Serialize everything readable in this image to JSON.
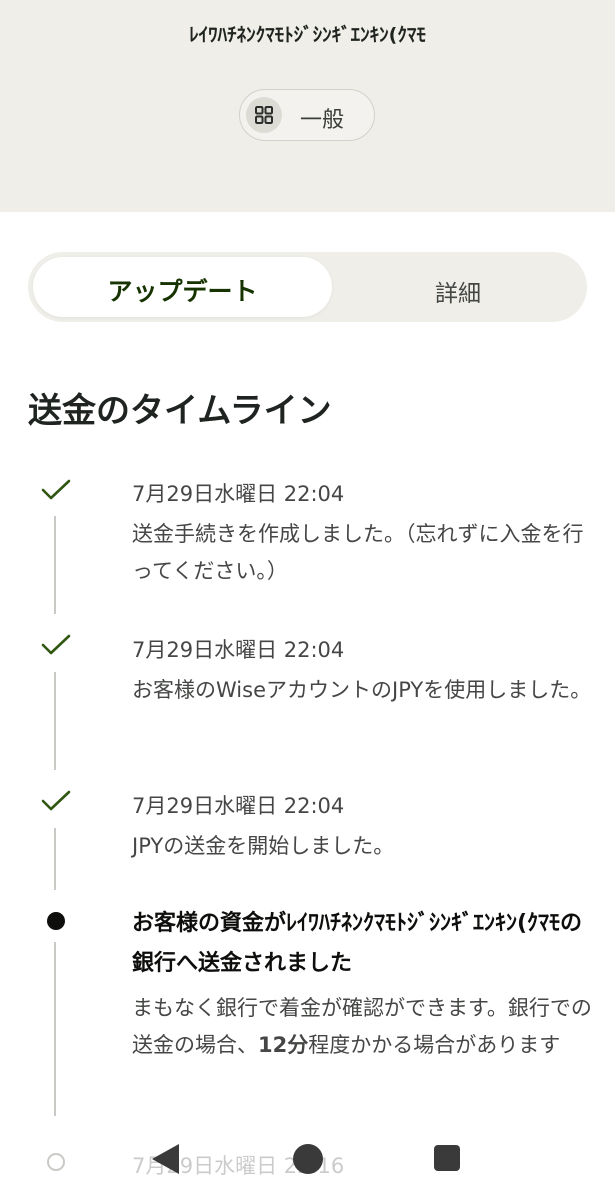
{
  "header": {
    "recipient_name": "ﾚｲﾜﾊﾁﾈﾝｸﾏﾓﾄｼﾞｼﾝｷﾞｴﾝｷﾝ(ｸﾏﾓ",
    "category_label": "一般",
    "category_icon": "grid-icon"
  },
  "tabs": {
    "updates": "アップデート",
    "details": "詳細",
    "active": "updates"
  },
  "timeline": {
    "title": "送金のタイムライン",
    "events": [
      {
        "status": "completed",
        "date": "7月29日水曜日 22:04",
        "text": "送金手続きを作成しました。（忘れずに入金を行ってください。）"
      },
      {
        "status": "completed",
        "date": "7月29日水曜日 22:04",
        "text": "お客様のWiseアカウントのJPYを使用しました。"
      },
      {
        "status": "completed",
        "date": "7月29日水曜日 22:04",
        "text": "JPYの送金を開始しました。"
      },
      {
        "status": "current",
        "title": "お客様の資金がﾚｲﾜﾊﾁﾈﾝｸﾏﾓﾄｼﾞｼﾝｷﾞｴﾝｷﾝ(ｸﾏﾓの銀行へ送金されました",
        "text_before": "まもなく銀行で着金が確認ができます。銀行での送金の場合、",
        "text_bold": "12分",
        "text_after": "程度かかる場合があります"
      },
      {
        "status": "pending",
        "date": "7月29日水曜日 22:16"
      }
    ]
  },
  "colors": {
    "header_bg": "#efeee9",
    "accent_green": "#163300",
    "check_green": "#2f5711"
  }
}
